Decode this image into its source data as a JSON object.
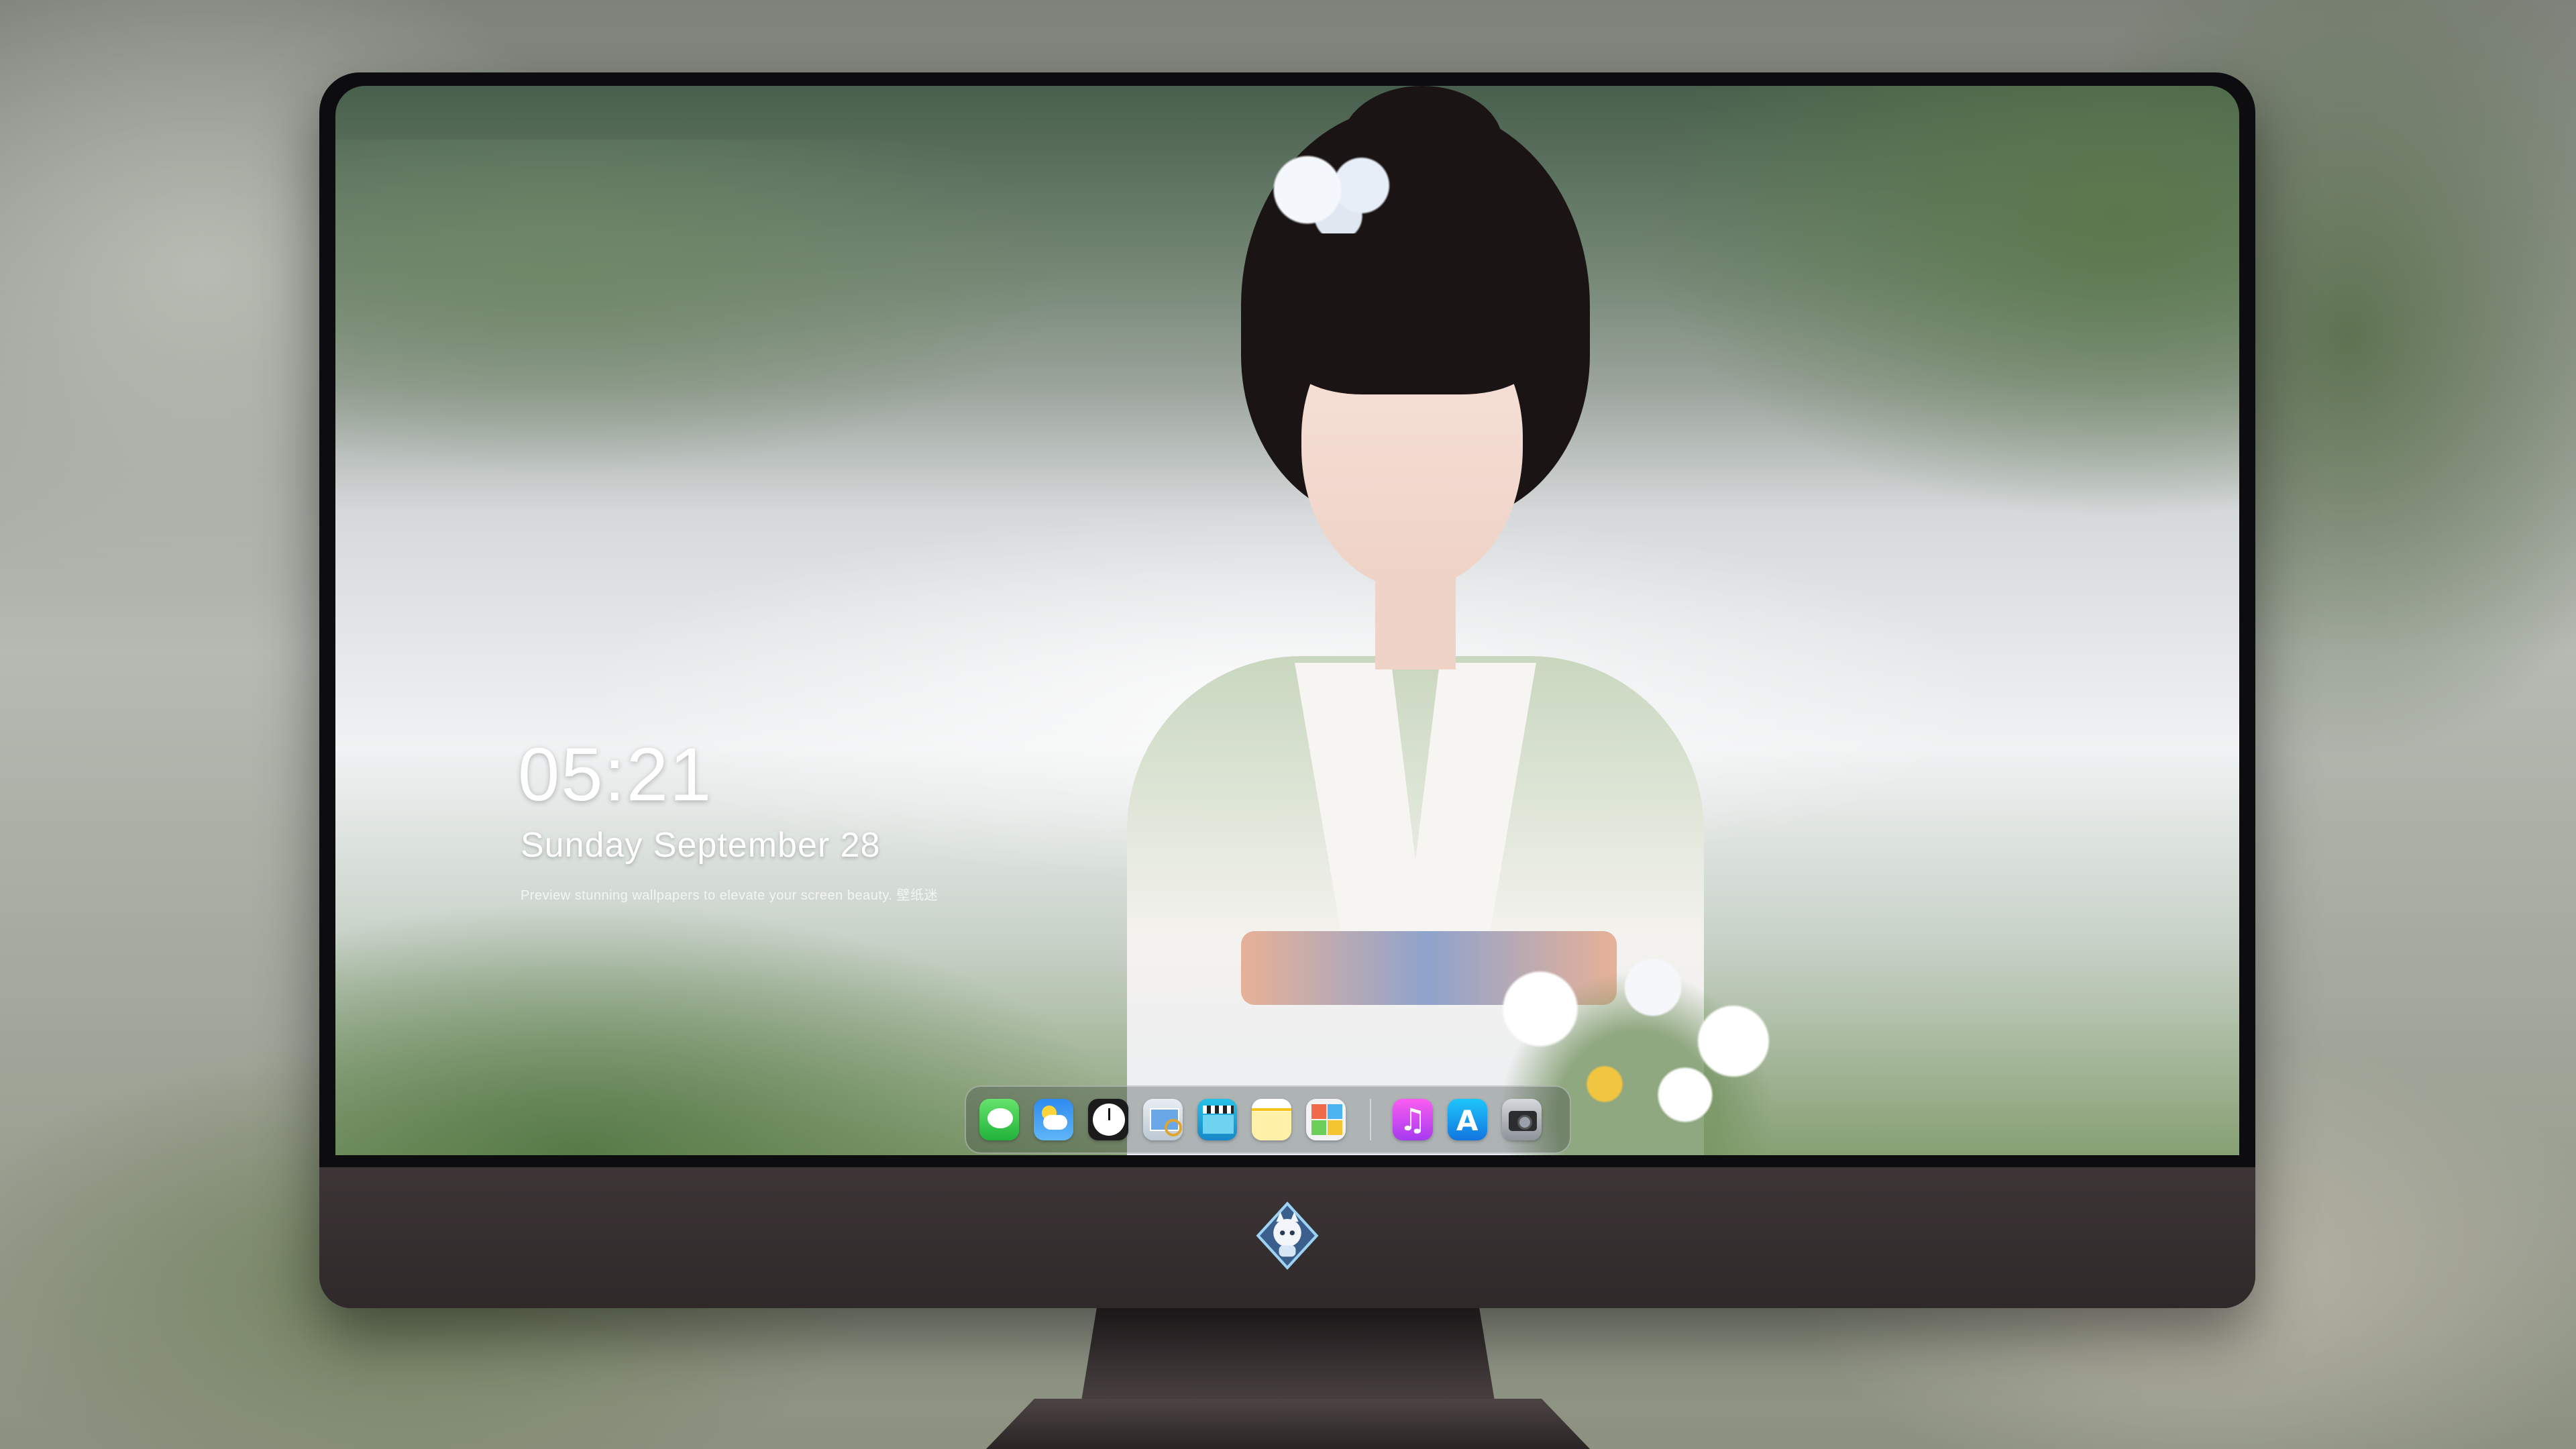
{
  "lockscreen": {
    "time": "05:21",
    "date": "Sunday September  28",
    "tagline": "Preview stunning wallpapers to elevate your screen beauty. 壁纸迷"
  },
  "dock": {
    "apps": [
      {
        "name": "messages",
        "icon": "messages-icon"
      },
      {
        "name": "weather",
        "icon": "weather-icon"
      },
      {
        "name": "clock",
        "icon": "clock-icon"
      },
      {
        "name": "preview",
        "icon": "preview-icon"
      },
      {
        "name": "video",
        "icon": "clapperboard-icon"
      },
      {
        "name": "notes",
        "icon": "notes-icon"
      },
      {
        "name": "photos",
        "icon": "photos-icon"
      },
      {
        "name": "music",
        "icon": "music-icon"
      },
      {
        "name": "app-store",
        "icon": "app-store-icon"
      },
      {
        "name": "camera",
        "icon": "camera-icon"
      }
    ]
  },
  "colors": {
    "bezel": "#0d0d0f",
    "chin": "#3a3233",
    "text": "#ffffff"
  }
}
